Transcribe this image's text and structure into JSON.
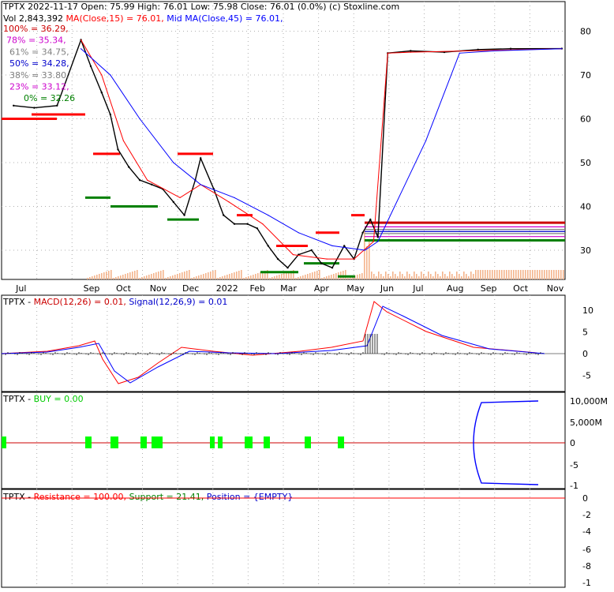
{
  "header": {
    "line1": "TPTX  2022-11-17 Open: 75.99  High: 76.01  Low: 75.98  Close: 76.01 (0.0%)  (c) Stoxline.com",
    "line2": "Vol 2,843,392",
    "ma15": "MA(Close,15) = 76.01,",
    "ma45": "Mid MA(Close,45) = 76.01,"
  },
  "fib_levels": [
    {
      "label": "100% = 36.29,",
      "value": 36.29,
      "color": "#cc0000"
    },
    {
      "label": "78% = 35.34,",
      "value": 35.34,
      "color": "#cc00cc"
    },
    {
      "label": "61% = 34.75,",
      "value": 34.75,
      "color": "#808080"
    },
    {
      "label": "50% = 34.28,",
      "value": 34.28,
      "color": "#0000cc"
    },
    {
      "label": "38% = 33.80,",
      "value": 33.8,
      "color": "#808080"
    },
    {
      "label": "23% = 33.12,",
      "value": 33.12,
      "color": "#cc00cc"
    },
    {
      "label": "0% = 32.26",
      "value": 32.26,
      "color": "#008000"
    }
  ],
  "colors": {
    "price": "#000000",
    "ma15": "#ff0000",
    "ma45": "#0000ff",
    "volume": "#f4b48c",
    "resistance": "#ff0000",
    "support": "#008000",
    "buy_marker": "#00ff00",
    "grid": "#b0b0b0"
  },
  "price_panel": {
    "y_ticks": [
      "80",
      "70",
      "60",
      "50",
      "40",
      "30"
    ],
    "x_ticks": [
      "Jul",
      "Sep",
      "Oct",
      "Nov",
      "Dec",
      "2022",
      "Feb",
      "Mar",
      "Apr",
      "May",
      "Jun",
      "Jul",
      "Aug",
      "Sep",
      "Oct",
      "Nov"
    ]
  },
  "macd_panel": {
    "prefix": "TPTX - ",
    "macd": "MACD(12,26) = 0.01,",
    "signal": "Signal(12,26,9) = 0.01",
    "y_ticks": [
      "10",
      "5",
      "0",
      "-5"
    ]
  },
  "buy_panel": {
    "prefix": "TPTX - ",
    "label": "BUY = 0.00",
    "y_ticks": [
      "10,000M",
      "5,000M",
      "0",
      "-5",
      "-1"
    ]
  },
  "rs_panel": {
    "prefix": "TPTX - ",
    "resistance": "Resistance = 100.00,",
    "support": "Support = 21.41,",
    "position": "Position = {EMPTY}",
    "y_ticks": [
      "0",
      "-2",
      "-4",
      "-6",
      "-8",
      "-1"
    ]
  },
  "chart_data": {
    "type": "line",
    "title": "TPTX 2022-11-17",
    "ylim": [
      22,
      85
    ],
    "series": [
      {
        "name": "Close",
        "x": [
          "2021-07-01",
          "2021-07-20",
          "2021-08-10",
          "2021-09-01",
          "2021-09-10",
          "2021-09-20",
          "2021-09-28",
          "2021-10-05",
          "2021-10-15",
          "2021-10-25",
          "2021-11-05",
          "2021-11-15",
          "2021-11-25",
          "2021-12-05",
          "2021-12-15",
          "2021-12-20",
          "2022-01-01",
          "2022-01-10",
          "2022-01-20",
          "2022-02-01",
          "2022-02-10",
          "2022-02-20",
          "2022-03-01",
          "2022-03-10",
          "2022-03-20",
          "2022-04-01",
          "2022-04-10",
          "2022-04-20",
          "2022-05-01",
          "2022-05-10",
          "2022-05-18",
          "2022-05-25",
          "2022-06-01",
          "2022-06-10",
          "2022-07-01",
          "2022-08-01",
          "2022-09-01",
          "2022-10-01",
          "2022-11-17"
        ],
        "values": [
          63,
          62.5,
          63,
          78,
          72,
          66,
          61,
          53,
          49,
          46,
          45,
          44,
          41,
          38,
          46,
          51,
          44,
          38,
          36,
          36,
          35,
          31,
          28,
          26,
          29,
          30,
          27,
          26,
          31,
          28,
          34,
          37,
          33,
          75,
          75.5,
          75.2,
          75.8,
          76,
          76.01
        ]
      },
      {
        "name": "MA(Close,15)",
        "x": [
          "2021-09-01",
          "2021-09-20",
          "2021-10-10",
          "2021-11-01",
          "2021-12-01",
          "2021-12-20",
          "2022-01-15",
          "2022-02-15",
          "2022-03-15",
          "2022-04-15",
          "2022-05-10",
          "2022-05-28",
          "2022-06-10",
          "2022-07-01",
          "2022-11-17"
        ],
        "values": [
          78,
          70,
          55,
          46,
          42,
          45,
          41,
          36,
          29,
          28,
          28,
          32,
          75,
          75.2,
          76
        ]
      },
      {
        "name": "Mid MA(Close,45)",
        "x": [
          "2021-09-01",
          "2021-09-28",
          "2021-10-25",
          "2021-11-25",
          "2021-12-20",
          "2022-01-20",
          "2022-02-20",
          "2022-03-20",
          "2022-04-20",
          "2022-05-20",
          "2022-06-01",
          "2022-07-15",
          "2022-08-15",
          "2022-09-15",
          "2022-11-17"
        ],
        "values": [
          76,
          70,
          60,
          50,
          45,
          42,
          38,
          34,
          31,
          30,
          32,
          55,
          75,
          75.5,
          76
        ]
      }
    ]
  }
}
